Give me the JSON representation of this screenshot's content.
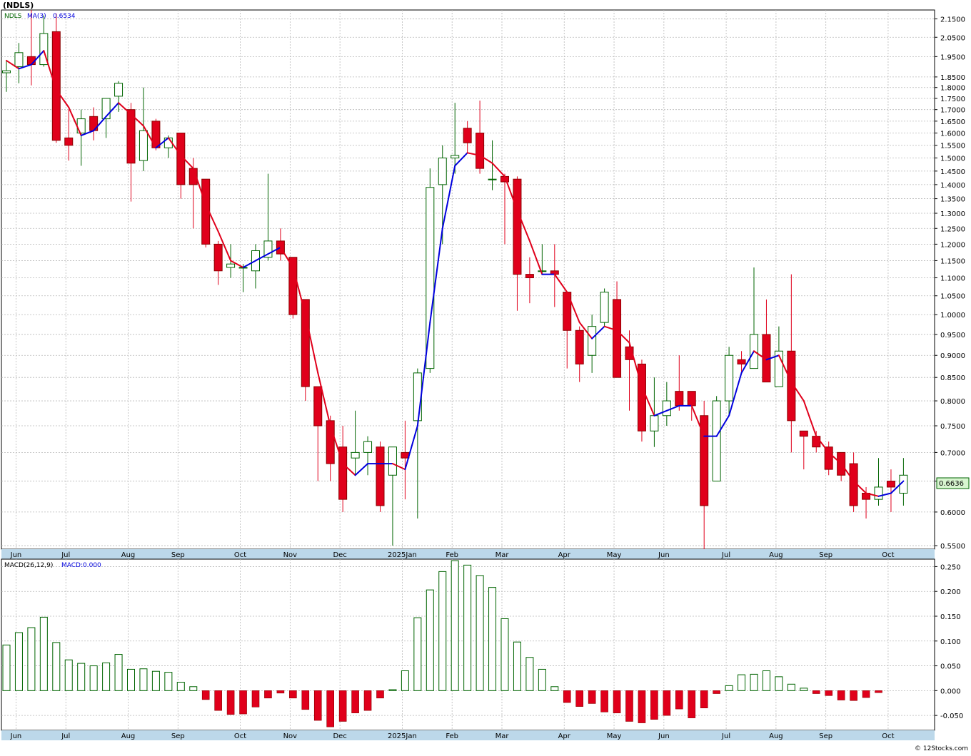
{
  "ticker_label": "(NDLS)",
  "footer": "© 12Stocks.com",
  "colors": {
    "up": "#006400",
    "down": "#e0001b",
    "ma_up": "#0000dd",
    "ma_down": "#e0001b",
    "axis_band": "#bcd8ea",
    "grid": "#b8b8b8",
    "price_tag_bg": "#d8f5d0"
  },
  "chart_data": [
    {
      "type": "candlestick",
      "legend": {
        "symbol": "NDLS",
        "ma": "MA(3)",
        "ma_value": "0.6534"
      },
      "last_price_tag": "0.6636",
      "y_scale": "log",
      "ylim": [
        0.545,
        2.2
      ],
      "y_ticks": [
        {
          "v": 0.55,
          "label": "0.5500"
        },
        {
          "v": 0.6,
          "label": "0.6000"
        },
        {
          "v": 0.65,
          "label": "0.6500"
        },
        {
          "v": 0.7,
          "label": "0.7000"
        },
        {
          "v": 0.75,
          "label": "0.7500"
        },
        {
          "v": 0.8,
          "label": "0.8000"
        },
        {
          "v": 0.85,
          "label": "0.8500"
        },
        {
          "v": 0.9,
          "label": "0.9000"
        },
        {
          "v": 0.95,
          "label": "0.9500"
        },
        {
          "v": 1.0,
          "label": "1.0000"
        },
        {
          "v": 1.05,
          "label": "1.0500"
        },
        {
          "v": 1.1,
          "label": "1.1000"
        },
        {
          "v": 1.15,
          "label": "1.1500"
        },
        {
          "v": 1.2,
          "label": "1.2000"
        },
        {
          "v": 1.25,
          "label": "1.2500"
        },
        {
          "v": 1.3,
          "label": "1.3000"
        },
        {
          "v": 1.35,
          "label": "1.3500"
        },
        {
          "v": 1.4,
          "label": "1.4000"
        },
        {
          "v": 1.45,
          "label": "1.4500"
        },
        {
          "v": 1.5,
          "label": "1.5000"
        },
        {
          "v": 1.55,
          "label": "1.5500"
        },
        {
          "v": 1.6,
          "label": "1.6000"
        },
        {
          "v": 1.65,
          "label": "1.6500"
        },
        {
          "v": 1.7,
          "label": "1.7000"
        },
        {
          "v": 1.75,
          "label": "1.7500"
        },
        {
          "v": 1.8,
          "label": "1.8000"
        },
        {
          "v": 1.85,
          "label": "1.8500"
        },
        {
          "v": 1.95,
          "label": "1.9500"
        },
        {
          "v": 2.05,
          "label": "2.0500"
        },
        {
          "v": 2.15,
          "label": "2.1500"
        }
      ],
      "months": [
        {
          "label": "Jun",
          "week": 1
        },
        {
          "label": "Jul",
          "week": 5
        },
        {
          "label": "Aug",
          "week": 10
        },
        {
          "label": "Sep",
          "week": 14
        },
        {
          "label": "Oct",
          "week": 19
        },
        {
          "label": "Nov",
          "week": 23
        },
        {
          "label": "Dec",
          "week": 27
        },
        {
          "label": "2025Jan",
          "week": 32
        },
        {
          "label": "Feb",
          "week": 36
        },
        {
          "label": "Mar",
          "week": 40
        },
        {
          "label": "Apr",
          "week": 45
        },
        {
          "label": "May",
          "week": 49
        },
        {
          "label": "Jun",
          "week": 53
        },
        {
          "label": "Jul",
          "week": 58
        },
        {
          "label": "Aug",
          "week": 62
        },
        {
          "label": "Sep",
          "week": 66
        },
        {
          "label": "Oct",
          "week": 71
        }
      ],
      "candles": [
        {
          "o": 1.87,
          "h": 1.93,
          "l": 1.78,
          "c": 1.88
        },
        {
          "o": 1.9,
          "h": 2.02,
          "l": 1.82,
          "c": 1.97
        },
        {
          "o": 1.95,
          "h": 2.2,
          "l": 1.81,
          "c": 1.91
        },
        {
          "o": 1.91,
          "h": 2.17,
          "l": 1.9,
          "c": 2.07
        },
        {
          "o": 2.08,
          "h": 2.18,
          "l": 1.56,
          "c": 1.57
        },
        {
          "o": 1.58,
          "h": 1.7,
          "l": 1.49,
          "c": 1.55
        },
        {
          "o": 1.6,
          "h": 1.7,
          "l": 1.47,
          "c": 1.66
        },
        {
          "o": 1.67,
          "h": 1.71,
          "l": 1.57,
          "c": 1.61
        },
        {
          "o": 1.66,
          "h": 1.75,
          "l": 1.58,
          "c": 1.75
        },
        {
          "o": 1.76,
          "h": 1.83,
          "l": 1.69,
          "c": 1.82
        },
        {
          "o": 1.7,
          "h": 1.73,
          "l": 1.34,
          "c": 1.48
        },
        {
          "o": 1.49,
          "h": 1.8,
          "l": 1.45,
          "c": 1.61
        },
        {
          "o": 1.65,
          "h": 1.66,
          "l": 1.53,
          "c": 1.54
        },
        {
          "o": 1.54,
          "h": 1.59,
          "l": 1.5,
          "c": 1.58
        },
        {
          "o": 1.6,
          "h": 1.6,
          "l": 1.35,
          "c": 1.4
        },
        {
          "o": 1.46,
          "h": 1.5,
          "l": 1.25,
          "c": 1.4
        },
        {
          "o": 1.42,
          "h": 1.42,
          "l": 1.19,
          "c": 1.2
        },
        {
          "o": 1.2,
          "h": 1.21,
          "l": 1.08,
          "c": 1.12
        },
        {
          "o": 1.13,
          "h": 1.2,
          "l": 1.1,
          "c": 1.14
        },
        {
          "o": 1.13,
          "h": 1.14,
          "l": 1.06,
          "c": 1.13
        },
        {
          "o": 1.12,
          "h": 1.2,
          "l": 1.07,
          "c": 1.18
        },
        {
          "o": 1.16,
          "h": 1.44,
          "l": 1.15,
          "c": 1.21
        },
        {
          "o": 1.21,
          "h": 1.25,
          "l": 1.15,
          "c": 1.17
        },
        {
          "o": 1.16,
          "h": 1.16,
          "l": 0.99,
          "c": 1.0
        },
        {
          "o": 1.04,
          "h": 1.04,
          "l": 0.8,
          "c": 0.83
        },
        {
          "o": 0.83,
          "h": 0.83,
          "l": 0.65,
          "c": 0.75
        },
        {
          "o": 0.76,
          "h": 0.77,
          "l": 0.65,
          "c": 0.68
        },
        {
          "o": 0.71,
          "h": 0.75,
          "l": 0.6,
          "c": 0.62
        },
        {
          "o": 0.69,
          "h": 0.78,
          "l": 0.66,
          "c": 0.7
        },
        {
          "o": 0.7,
          "h": 0.73,
          "l": 0.66,
          "c": 0.72
        },
        {
          "o": 0.71,
          "h": 0.72,
          "l": 0.6,
          "c": 0.61
        },
        {
          "o": 0.66,
          "h": 0.71,
          "l": 0.55,
          "c": 0.71
        },
        {
          "o": 0.7,
          "h": 0.76,
          "l": 0.62,
          "c": 0.69
        },
        {
          "o": 0.76,
          "h": 0.87,
          "l": 0.59,
          "c": 0.86
        },
        {
          "o": 0.87,
          "h": 1.46,
          "l": 0.86,
          "c": 1.39
        },
        {
          "o": 1.4,
          "h": 1.55,
          "l": 1.2,
          "c": 1.5
        },
        {
          "o": 1.5,
          "h": 1.73,
          "l": 1.44,
          "c": 1.51
        },
        {
          "o": 1.62,
          "h": 1.65,
          "l": 1.52,
          "c": 1.56
        },
        {
          "o": 1.6,
          "h": 1.74,
          "l": 1.44,
          "c": 1.46
        },
        {
          "o": 1.42,
          "h": 1.57,
          "l": 1.38,
          "c": 1.42
        },
        {
          "o": 1.43,
          "h": 1.44,
          "l": 1.2,
          "c": 1.41
        },
        {
          "o": 1.42,
          "h": 1.43,
          "l": 1.01,
          "c": 1.11
        },
        {
          "o": 1.11,
          "h": 1.16,
          "l": 1.03,
          "c": 1.1
        },
        {
          "o": 1.12,
          "h": 1.2,
          "l": 1.11,
          "c": 1.12
        },
        {
          "o": 1.12,
          "h": 1.2,
          "l": 1.02,
          "c": 1.11
        },
        {
          "o": 1.06,
          "h": 1.06,
          "l": 0.87,
          "c": 0.96
        },
        {
          "o": 0.96,
          "h": 0.97,
          "l": 0.84,
          "c": 0.88
        },
        {
          "o": 0.9,
          "h": 1.0,
          "l": 0.86,
          "c": 0.97
        },
        {
          "o": 0.98,
          "h": 1.07,
          "l": 0.97,
          "c": 1.06
        },
        {
          "o": 1.04,
          "h": 1.09,
          "l": 0.85,
          "c": 0.85
        },
        {
          "o": 0.92,
          "h": 0.96,
          "l": 0.78,
          "c": 0.89
        },
        {
          "o": 0.88,
          "h": 0.89,
          "l": 0.72,
          "c": 0.74
        },
        {
          "o": 0.74,
          "h": 0.85,
          "l": 0.71,
          "c": 0.77
        },
        {
          "o": 0.77,
          "h": 0.84,
          "l": 0.75,
          "c": 0.8
        },
        {
          "o": 0.82,
          "h": 0.9,
          "l": 0.78,
          "c": 0.79
        },
        {
          "o": 0.82,
          "h": 0.82,
          "l": 0.76,
          "c": 0.79
        },
        {
          "o": 0.77,
          "h": 0.8,
          "l": 0.54,
          "c": 0.61
        },
        {
          "o": 0.65,
          "h": 0.81,
          "l": 0.65,
          "c": 0.8
        },
        {
          "o": 0.8,
          "h": 0.92,
          "l": 0.77,
          "c": 0.9
        },
        {
          "o": 0.89,
          "h": 0.91,
          "l": 0.86,
          "c": 0.88
        },
        {
          "o": 0.87,
          "h": 1.13,
          "l": 0.87,
          "c": 0.95
        },
        {
          "o": 0.95,
          "h": 1.04,
          "l": 0.84,
          "c": 0.84
        },
        {
          "o": 0.83,
          "h": 0.97,
          "l": 0.83,
          "c": 0.91
        },
        {
          "o": 0.91,
          "h": 1.11,
          "l": 0.7,
          "c": 0.76
        },
        {
          "o": 0.74,
          "h": 0.74,
          "l": 0.67,
          "c": 0.73
        },
        {
          "o": 0.73,
          "h": 0.74,
          "l": 0.7,
          "c": 0.71
        },
        {
          "o": 0.71,
          "h": 0.72,
          "l": 0.66,
          "c": 0.67
        },
        {
          "o": 0.7,
          "h": 0.7,
          "l": 0.65,
          "c": 0.66
        },
        {
          "o": 0.68,
          "h": 0.7,
          "l": 0.6,
          "c": 0.61
        },
        {
          "o": 0.63,
          "h": 0.64,
          "l": 0.59,
          "c": 0.62
        },
        {
          "o": 0.62,
          "h": 0.69,
          "l": 0.61,
          "c": 0.64
        },
        {
          "o": 0.65,
          "h": 0.67,
          "l": 0.6,
          "c": 0.64
        },
        {
          "o": 0.63,
          "h": 0.69,
          "l": 0.61,
          "c": 0.66
        }
      ],
      "ma3": [
        1.93,
        1.89,
        1.91,
        1.98,
        1.79,
        1.71,
        1.59,
        1.61,
        1.67,
        1.73,
        1.68,
        1.63,
        1.54,
        1.58,
        1.51,
        1.46,
        1.33,
        1.24,
        1.15,
        1.13,
        1.15,
        1.17,
        1.19,
        1.13,
        1.0,
        0.86,
        0.75,
        0.68,
        0.66,
        0.68,
        0.68,
        0.68,
        0.67,
        0.75,
        0.98,
        1.25,
        1.47,
        1.52,
        1.51,
        1.48,
        1.43,
        1.31,
        1.21,
        1.11,
        1.11,
        1.06,
        0.98,
        0.94,
        0.97,
        0.96,
        0.93,
        0.83,
        0.77,
        0.78,
        0.79,
        0.79,
        0.73,
        0.73,
        0.77,
        0.86,
        0.91,
        0.89,
        0.9,
        0.84,
        0.8,
        0.73,
        0.7,
        0.68,
        0.65,
        0.63,
        0.625,
        0.63,
        0.65
      ]
    },
    {
      "type": "bar",
      "legend": {
        "name": "MACD(26,12,9)",
        "value_label": "MACD:0.000"
      },
      "ylim": [
        -0.08,
        0.265
      ],
      "y_ticks": [
        {
          "v": -0.05,
          "label": "-0.050"
        },
        {
          "v": 0,
          "label": "0.000"
        },
        {
          "v": 0.05,
          "label": "0.050"
        },
        {
          "v": 0.1,
          "label": "0.100"
        },
        {
          "v": 0.15,
          "label": "0.150"
        },
        {
          "v": 0.2,
          "label": "0.200"
        },
        {
          "v": 0.25,
          "label": "0.250"
        }
      ],
      "values": [
        0.092,
        0.117,
        0.127,
        0.148,
        0.097,
        0.062,
        0.055,
        0.05,
        0.056,
        0.073,
        0.043,
        0.044,
        0.039,
        0.037,
        0.017,
        0.008,
        -0.018,
        -0.04,
        -0.048,
        -0.047,
        -0.033,
        -0.015,
        -0.005,
        -0.015,
        -0.038,
        -0.06,
        -0.073,
        -0.062,
        -0.045,
        -0.04,
        -0.015,
        0.002,
        0.04,
        0.147,
        0.203,
        0.24,
        0.262,
        0.253,
        0.232,
        0.208,
        0.145,
        0.098,
        0.067,
        0.043,
        0.008,
        -0.024,
        -0.032,
        -0.026,
        -0.043,
        -0.045,
        -0.062,
        -0.065,
        -0.058,
        -0.05,
        -0.037,
        -0.055,
        -0.035,
        -0.006,
        0.01,
        0.032,
        0.033,
        0.04,
        0.028,
        0.013,
        0.005,
        -0.006,
        -0.01,
        -0.019,
        -0.02,
        -0.014,
        -0.004
      ],
      "months": [
        {
          "label": "Jun",
          "week": 1
        },
        {
          "label": "Jul",
          "week": 5
        },
        {
          "label": "Aug",
          "week": 10
        },
        {
          "label": "Sep",
          "week": 14
        },
        {
          "label": "Oct",
          "week": 19
        },
        {
          "label": "Nov",
          "week": 23
        },
        {
          "label": "Dec",
          "week": 27
        },
        {
          "label": "2025Jan",
          "week": 32
        },
        {
          "label": "Feb",
          "week": 36
        },
        {
          "label": "Mar",
          "week": 40
        },
        {
          "label": "Apr",
          "week": 45
        },
        {
          "label": "May",
          "week": 49
        },
        {
          "label": "Jun",
          "week": 53
        },
        {
          "label": "Jul",
          "week": 58
        },
        {
          "label": "Aug",
          "week": 62
        },
        {
          "label": "Sep",
          "week": 66
        },
        {
          "label": "Oct",
          "week": 71
        }
      ]
    }
  ]
}
